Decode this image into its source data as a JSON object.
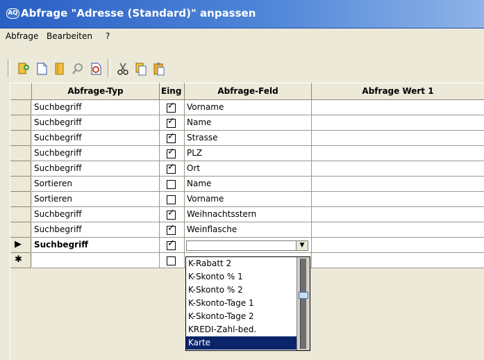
{
  "window": {
    "app_icon_text": "AQ",
    "title": "Abfrage \"Adresse (Standard)\" anpassen"
  },
  "menu": [
    {
      "label": "Abfrage"
    },
    {
      "label": "Bearbeiten"
    },
    {
      "label": "?"
    }
  ],
  "toolbar": {
    "buttons": [
      {
        "name": "new-query-icon"
      },
      {
        "name": "new-document-icon"
      },
      {
        "name": "open-book-icon"
      },
      {
        "name": "search-icon"
      },
      {
        "name": "preview-icon"
      },
      {
        "name": "cut-icon"
      },
      {
        "name": "copy-icon"
      },
      {
        "name": "paste-icon"
      }
    ]
  },
  "grid": {
    "columns": [
      "Abfrage-Typ",
      "Eing",
      "Abfrage-Feld",
      "Abfrage Wert 1"
    ],
    "rows": [
      {
        "typ": "Suchbegriff",
        "checked": true,
        "feld": "Vorname"
      },
      {
        "typ": "Suchbegriff",
        "checked": true,
        "feld": "Name"
      },
      {
        "typ": "Suchbegriff",
        "checked": true,
        "feld": "Strasse"
      },
      {
        "typ": "Suchbegriff",
        "checked": true,
        "feld": "PLZ"
      },
      {
        "typ": "Suchbegriff",
        "checked": true,
        "feld": "Ort"
      },
      {
        "typ": "Sortieren",
        "checked": false,
        "feld": "Name"
      },
      {
        "typ": "Sortieren",
        "checked": false,
        "feld": "Vorname"
      },
      {
        "typ": "Suchbegriff",
        "checked": true,
        "feld": "Weihnachtsstern"
      },
      {
        "typ": "Suchbegriff",
        "checked": true,
        "feld": "Weinflasche"
      },
      {
        "typ": "Suchbegriff",
        "checked": true,
        "feld": "",
        "current": true
      },
      {
        "typ": "",
        "checked": false,
        "feld": "",
        "new": true
      }
    ],
    "current_marker": "▶",
    "new_marker": "✱",
    "check_mark": "✓"
  },
  "dropdown": {
    "items": [
      "K-Rabatt 2",
      "K-Skonto % 1",
      "K-Skonto % 2",
      "K-Skonto-Tage 1",
      "K-Skonto-Tage 2",
      "KREDI-Zahl-bed.",
      "Karte"
    ],
    "selected": "Karte"
  }
}
